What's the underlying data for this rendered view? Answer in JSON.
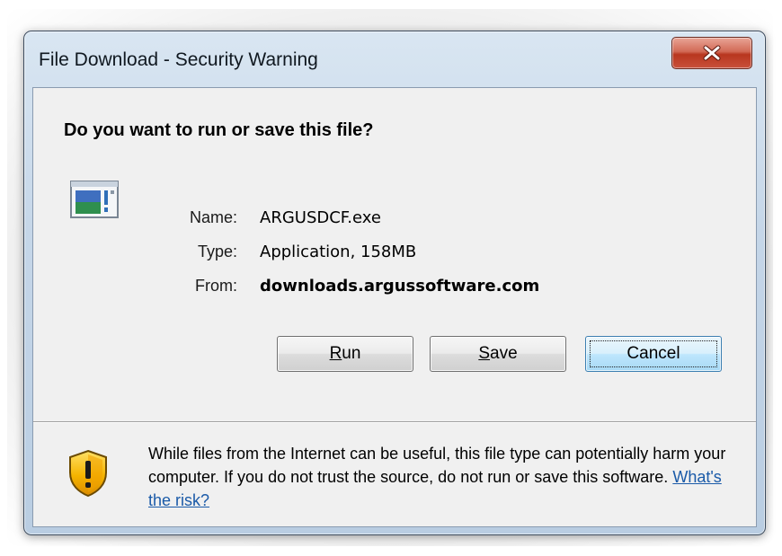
{
  "window": {
    "title": "File Download - Security Warning"
  },
  "dialog": {
    "question": "Do you want to run or save this file?",
    "fields": [
      {
        "label": "Name:",
        "value": "ARGUSDCF.exe"
      },
      {
        "label": "Type:",
        "value": "Application, 158MB"
      },
      {
        "label": "From:",
        "value": "downloads.argussoftware.com"
      }
    ],
    "buttons": {
      "run": {
        "accel": "R",
        "rest": "un"
      },
      "save": {
        "accel": "S",
        "rest": "ave"
      },
      "cancel": "Cancel"
    },
    "warning": {
      "text": "While files from the Internet can be useful, this file type can potentially harm your computer. If you do not trust the source, do not run or save this software.",
      "link": "What's the risk?"
    }
  },
  "icons": {
    "close": "close-icon",
    "file": "application-file-icon",
    "shield": "security-shield-icon"
  }
}
